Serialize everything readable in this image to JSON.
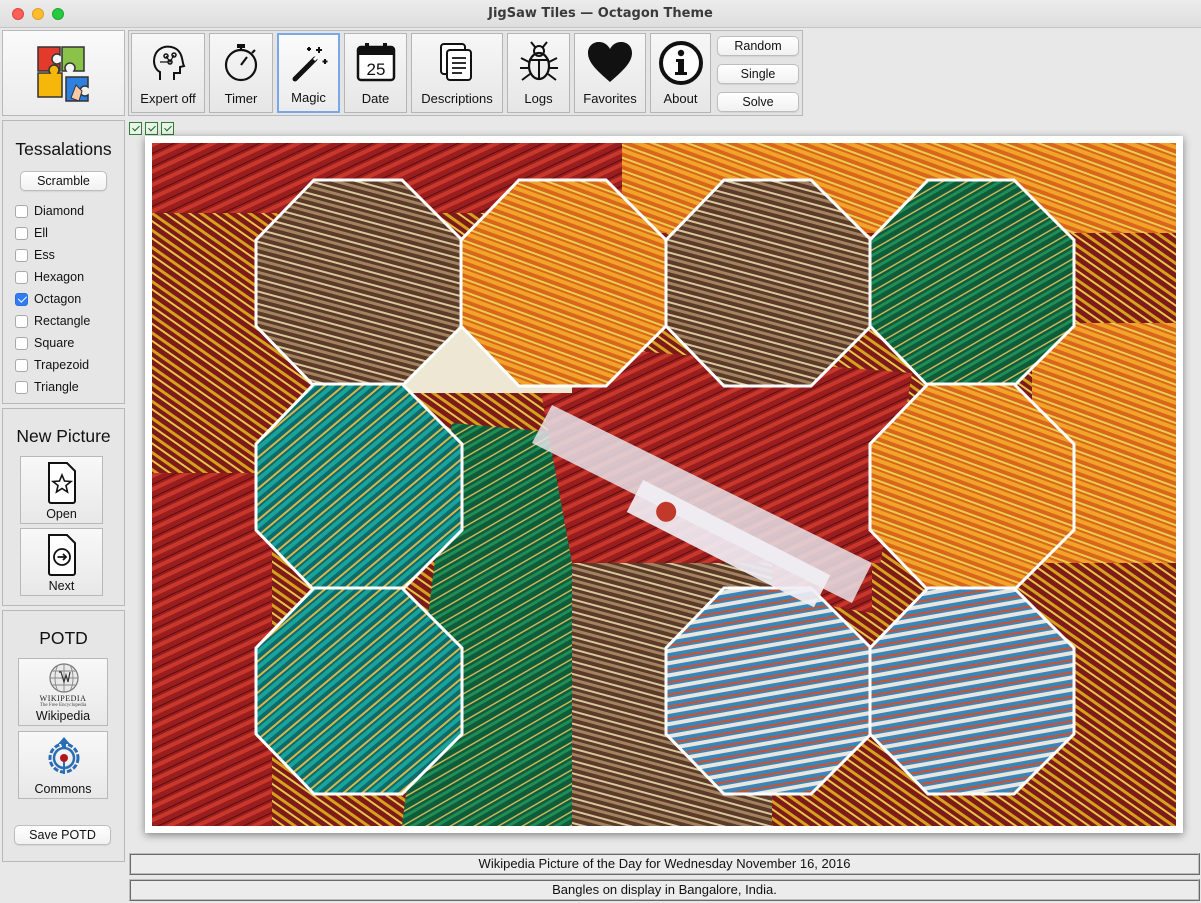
{
  "window": {
    "title": "JigSaw Tiles — Octagon Theme"
  },
  "toolbar": {
    "tools": [
      {
        "label": "Expert off",
        "icon": "brain-head-icon"
      },
      {
        "label": "Timer",
        "icon": "stopwatch-icon"
      },
      {
        "label": "Magic",
        "icon": "magic-wand-icon",
        "active": true
      },
      {
        "label": "Date",
        "icon": "calendar-icon",
        "day": "25"
      },
      {
        "label": "Descriptions",
        "icon": "documents-icon"
      },
      {
        "label": "Logs",
        "icon": "bug-icon"
      },
      {
        "label": "Favorites",
        "icon": "heart-icon"
      },
      {
        "label": "About",
        "icon": "info-icon"
      }
    ],
    "random_label": "Random",
    "single_label": "Single",
    "solve_label": "Solve"
  },
  "tessellations": {
    "title": "Tessalations",
    "scramble_label": "Scramble",
    "options": [
      {
        "label": "Diamond",
        "checked": false
      },
      {
        "label": "Ell",
        "checked": false
      },
      {
        "label": "Ess",
        "checked": false
      },
      {
        "label": "Hexagon",
        "checked": false
      },
      {
        "label": "Octagon",
        "checked": true
      },
      {
        "label": "Rectangle",
        "checked": false
      },
      {
        "label": "Square",
        "checked": false
      },
      {
        "label": "Trapezoid",
        "checked": false
      },
      {
        "label": "Triangle",
        "checked": false
      }
    ]
  },
  "new_picture": {
    "title": "New Picture",
    "open_label": "Open",
    "next_label": "Next"
  },
  "potd": {
    "title": "POTD",
    "wikipedia_label": "Wikipedia",
    "wikipedia_logo_text": "WIKIPEDIA",
    "wikipedia_logo_sub": "The Free Encyclopedia",
    "commons_label": "Commons",
    "save_label": "Save POTD"
  },
  "status": {
    "line1": "Wikipedia Picture of the Day for Wednesday November 16, 2016",
    "line2": "Bangles on display in Bangalore, India."
  },
  "colors": {
    "accent": "#2f7cf6",
    "active_border": "#7aa7e6"
  }
}
